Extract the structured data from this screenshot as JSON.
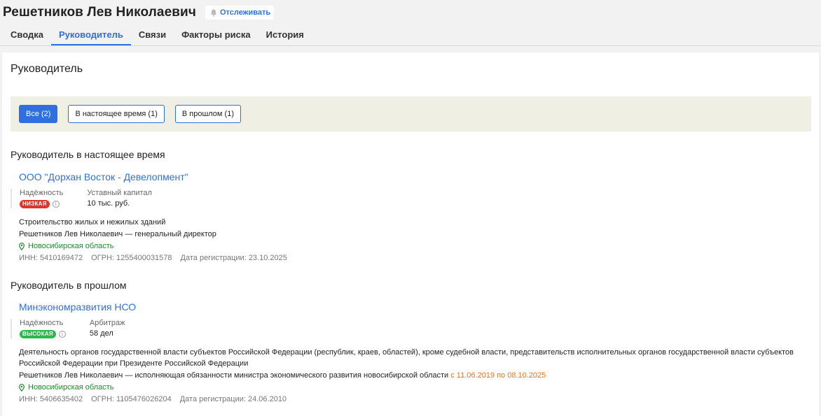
{
  "header": {
    "person_name": "Решетников Лев Николаевич",
    "follow_label": "Отслеживать"
  },
  "tabs": [
    {
      "label": "Сводка"
    },
    {
      "label": "Руководитель",
      "active": true
    },
    {
      "label": "Связи"
    },
    {
      "label": "Факторы риска"
    },
    {
      "label": "История"
    }
  ],
  "page_title": "Руководитель",
  "filters": [
    {
      "label": "Все (2)",
      "active": true
    },
    {
      "label": "В настоящее время (1)"
    },
    {
      "label": "В прошлом (1)"
    }
  ],
  "sections": {
    "current": {
      "title": "Руководитель в настоящее время",
      "company": {
        "name": "ООО \"Дорхан Восток - Девелопмент\"",
        "reliability_label": "Надёжность",
        "reliability_value": "НИЗКАЯ",
        "metric_label": "Уставный капитал",
        "metric_value": "10 тыс. руб.",
        "activity": "Строительство жилых и нежилых зданий",
        "role": "Решетников Лев Николаевич — генеральный директор",
        "region": "Новосибирская область",
        "inn": "ИНН: 5410169472",
        "ogrn": "ОГРН: 1255400031578",
        "reg_date": "Дата регистрации: 23.10.2025"
      }
    },
    "past": {
      "title": "Руководитель в прошлом",
      "company": {
        "name": "Минэкономразвития НСО",
        "reliability_label": "Надёжность",
        "reliability_value": "ВЫСОКАЯ",
        "metric_label": "Арбитраж",
        "metric_value": "58 дел",
        "activity_line1": "Деятельность органов государственной власти субъектов Российской Федерации (республик, краев, областей), кроме судебной власти, представительств исполнительных органов государственной власти субъектов",
        "activity_line2": "Российской Федерации при Президенте Российской Федерации",
        "role": "Решетников Лев Николаевич — исполняющая обязанности министра экономического развития новосибирской области",
        "period": "с 11.06.2019 по 08.10.2025",
        "region": "Новосибирская область",
        "inn": "ИНН: 5406635402",
        "ogrn": "ОГРН: 1105476026204",
        "reg_date": "Дата регистрации: 24.06.2010"
      }
    }
  },
  "colors": {
    "accent": "#2f6fe0",
    "low_badge": "#e0352b",
    "high_badge": "#2db84d",
    "region": "#1d8a2c",
    "period": "#e8701a"
  }
}
